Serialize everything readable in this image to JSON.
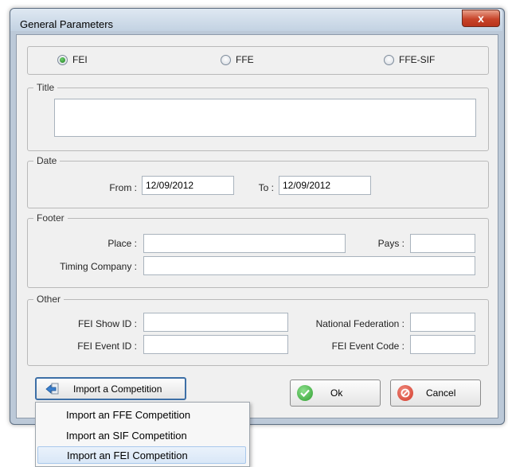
{
  "window": {
    "title": "General Parameters",
    "close_glyph": "x"
  },
  "mode": {
    "options": [
      "FEI",
      "FFE",
      "FFE-SIF"
    ],
    "selected": "FEI"
  },
  "title_group": {
    "legend": "Title",
    "value": ""
  },
  "date_group": {
    "legend": "Date",
    "from_label": "From :",
    "from_value": "12/09/2012",
    "to_label": "To :",
    "to_value": "12/09/2012"
  },
  "footer_group": {
    "legend": "Footer",
    "place_label": "Place :",
    "place_value": "",
    "pays_label": "Pays :",
    "pays_value": "",
    "timing_label": "Timing Company :",
    "timing_value": ""
  },
  "other_group": {
    "legend": "Other",
    "show_id_label": "FEI Show ID :",
    "show_id_value": "",
    "event_id_label": "FEI Event ID :",
    "event_id_value": "",
    "national_fed_label": "National Federation :",
    "national_fed_value": "",
    "event_code_label": "FEI Event Code :",
    "event_code_value": ""
  },
  "buttons": {
    "import_label": "Import a Competition",
    "ok_label": "Ok",
    "cancel_label": "Cancel"
  },
  "import_menu": {
    "items": [
      "Import an FFE Competition",
      "Import an SIF Competition",
      "Import an FEI Competition"
    ],
    "highlighted_index": 2
  },
  "colors": {
    "ok_green": "#2f9e2f",
    "cancel_red": "#d23a2a",
    "import_blue": "#3d6fa6"
  },
  "icons": {
    "import": "import-arrow-icon",
    "ok": "checkmark-icon",
    "cancel": "no-entry-icon",
    "close": "close-icon"
  }
}
